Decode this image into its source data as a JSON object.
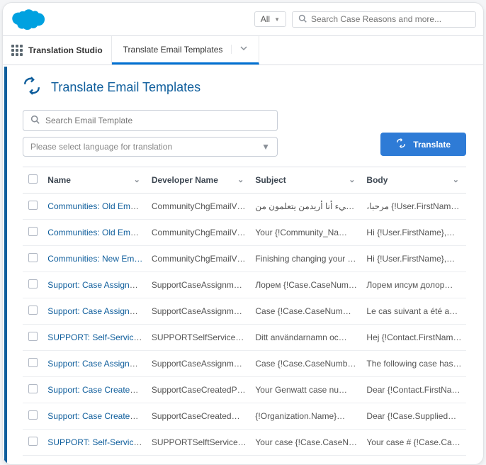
{
  "topbar": {
    "all_label": "All",
    "search_placeholder": "Search Case Reasons and more..."
  },
  "app_name": "Translation Studio",
  "active_tab": "Translate Email Templates",
  "page_title": "Translate Email Templates",
  "search_template_placeholder": "Search Email Template",
  "language_placeholder": "Please select language for translation",
  "translate_btn": "Translate",
  "columns": {
    "name": "Name",
    "dev": "Developer Name",
    "subject": "Subject",
    "body": "Body"
  },
  "rows": [
    {
      "name": "Communities: Old Ema…",
      "dev": "CommunityChgEmailV…",
      "subject": "صحة أي شيء أنا أريدمن يتعلمون من…",
      "body": "،مرحبا {!User.FirstName}…"
    },
    {
      "name": "Communities: Old Ema…",
      "dev": "CommunityChgEmailV…",
      "subject": "Your {!Community_Na…",
      "body": "Hi {!User.FirstName},W…"
    },
    {
      "name": "Communities: New Em…",
      "dev": "CommunityChgEmailV…",
      "subject": "Finishing changing your {!…",
      "body": "Hi {!User.FirstName},W…"
    },
    {
      "name": "Support: Case Assignm…",
      "dev": "SupportCaseAssignme…",
      "subject": "Лорем {!Case.CaseNum…",
      "body": "Лорем ипсум долор…"
    },
    {
      "name": "Support: Case Assignm…",
      "dev": "SupportCaseAssignme…",
      "subject": "Case {!Case.CaseNum…",
      "body": "Le cas suivant a été aut…"
    },
    {
      "name": "SUPPORT: Self-Service …",
      "dev": "SUPPORTSelfServiceNe…",
      "subject": "Ditt användarnamn oc…",
      "body": "Hej {!Contact.FirstNam…"
    },
    {
      "name": "Support: Case Assignm…",
      "dev": "SupportCaseAssignme…",
      "subject": "Case {!Case.CaseNumb…",
      "body": "The following case has…"
    },
    {
      "name": "Support: Case Created …",
      "dev": "SupportCaseCreatedPh…",
      "subject": "Your Genwatt case nu…",
      "body": "Dear {!Contact.FirstNa…"
    },
    {
      "name": "Support: Case Created …",
      "dev": "SupportCaseCreatedW…",
      "subject": "{!Organization.Name}…",
      "body": "Dear {!Case.SuppliedNa…"
    },
    {
      "name": "SUPPORT: Self-Service …",
      "dev": "SUPPORTSelftServiceNe…",
      "subject": "Your case {!Case.CaseN…",
      "body": "Your case # {!Case.Case…"
    }
  ]
}
